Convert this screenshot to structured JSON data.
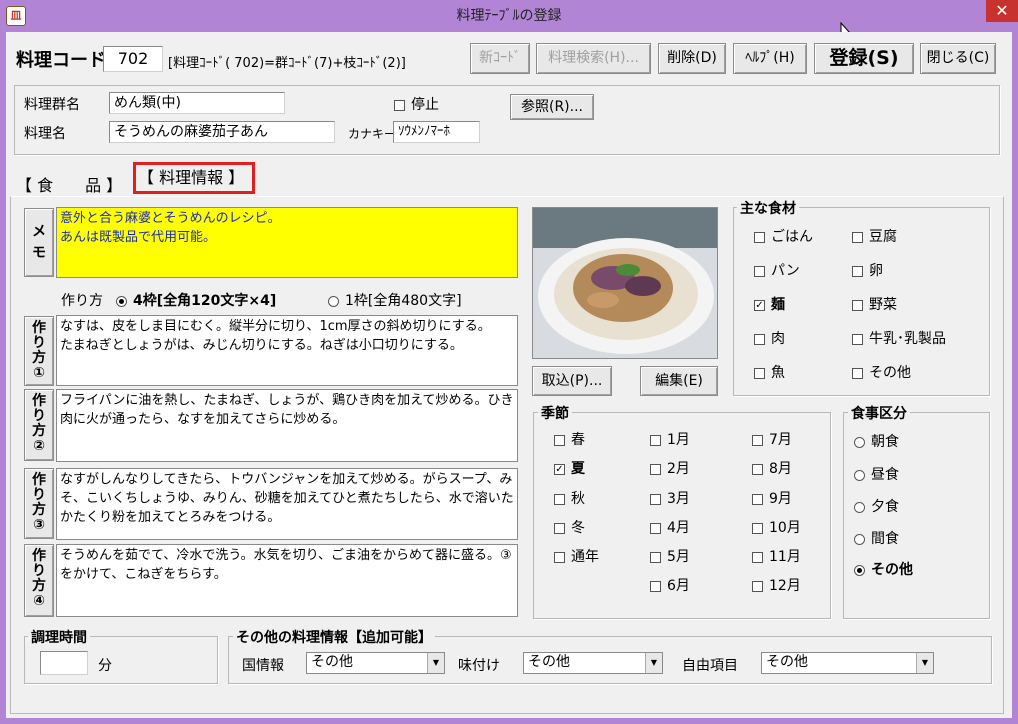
{
  "window": {
    "title": "料理ﾃｰﾌﾞﾙの登録",
    "app_icon_glyph": "皿",
    "close_glyph": "✕"
  },
  "header": {
    "code_label": "料理コード",
    "code_value": "702",
    "code_hint": "[料理ｺｰﾄﾞ( 702)=群ｺｰﾄﾞ(7)+枝ｺｰﾄﾞ(2)]",
    "buttons": {
      "new_code": "新ｺｰﾄﾞ",
      "search": "料理検索(H)...",
      "delete": "削除(D)",
      "help": "ﾍﾙﾌﾟ(H)",
      "register": "登録(S)",
      "close": "閉じる(C)"
    }
  },
  "info": {
    "group_label": "料理群名",
    "group_value": "めん類(中)",
    "stop_label": "停止",
    "ref_button": "参照(R)...",
    "name_label": "料理名",
    "name_value": "そうめんの麻婆茄子あん",
    "kana_label": "カナキー",
    "kana_value": "ｿｳﾒﾝﾉﾏｰﾎ"
  },
  "tabs": {
    "food": "【 食　　品 】",
    "recipe_info": "【 料理情報 】"
  },
  "memo": {
    "button": "メモ",
    "text": "意外と合う麻婆とそうめんのレシピ。\nあんは既製品で代用可能。"
  },
  "method_mode": {
    "label": "作り方",
    "opt1": "4枠[全角120文字×4]",
    "opt2": "1枠[全角480文字]"
  },
  "steps": [
    {
      "button": "作り方①",
      "text": "なすは、皮をしま目にむく。縦半分に切り、1cm厚さの斜め切りにする。\nたまねぎとしょうがは、みじん切りにする。ねぎは小口切りにする。"
    },
    {
      "button": "作り方②",
      "text": "フライパンに油を熱し、たまねぎ、しょうが、鶏ひき肉を加えて炒める。ひき肉に火が通ったら、なすを加えてさらに炒める。"
    },
    {
      "button": "作り方③",
      "text": "なすがしんなりしてきたら、トウバンジャンを加えて炒める。がらスープ、みそ、こいくちしょうゆ、みりん、砂糖を加えてひと煮たちしたら、水で溶いたかたくり粉を加えてとろみをつける。"
    },
    {
      "button": "作り方④",
      "text": "そうめんを茹でて、冷水で洗う。水気を切り、ごま油をからめて器に盛る。③をかけて、こねぎをちらす。"
    }
  ],
  "photo": {
    "import_button": "取込(P)...",
    "edit_button": "編集(E)"
  },
  "ingredients": {
    "title": "主な食材",
    "items": [
      {
        "label": "ごはん",
        "checked": false
      },
      {
        "label": "豆腐",
        "checked": false
      },
      {
        "label": "パン",
        "checked": false
      },
      {
        "label": "卵",
        "checked": false
      },
      {
        "label": "麺",
        "checked": true
      },
      {
        "label": "野菜",
        "checked": false
      },
      {
        "label": "肉",
        "checked": false
      },
      {
        "label": "牛乳･乳製品",
        "checked": false
      },
      {
        "label": "魚",
        "checked": false
      },
      {
        "label": "その他",
        "checked": false
      }
    ]
  },
  "season": {
    "title": "季節",
    "seasons": [
      {
        "label": "春",
        "checked": false
      },
      {
        "label": "夏",
        "checked": true
      },
      {
        "label": "秋",
        "checked": false
      },
      {
        "label": "冬",
        "checked": false
      },
      {
        "label": "通年",
        "checked": false
      }
    ],
    "months": [
      "1月",
      "2月",
      "3月",
      "4月",
      "5月",
      "6月",
      "7月",
      "8月",
      "9月",
      "10月",
      "11月",
      "12月"
    ]
  },
  "meal_type": {
    "title": "食事区分",
    "options": [
      "朝食",
      "昼食",
      "夕食",
      "間食",
      "その他"
    ],
    "selected": "その他"
  },
  "cook_time": {
    "title": "調理時間",
    "value": "",
    "unit": "分"
  },
  "other_info": {
    "title": "その他の料理情報【追加可能】",
    "country_label": "国情報",
    "country_value": "その他",
    "flavor_label": "味付け",
    "flavor_value": "その他",
    "free_label": "自由項目",
    "free_value": "その他"
  },
  "colors": {
    "titlebar": "#b184d6",
    "memo_bg": "#ffff00",
    "memo_text": "#1a2cb0",
    "tab_highlight": "#e02020",
    "close": "#c8322e"
  }
}
